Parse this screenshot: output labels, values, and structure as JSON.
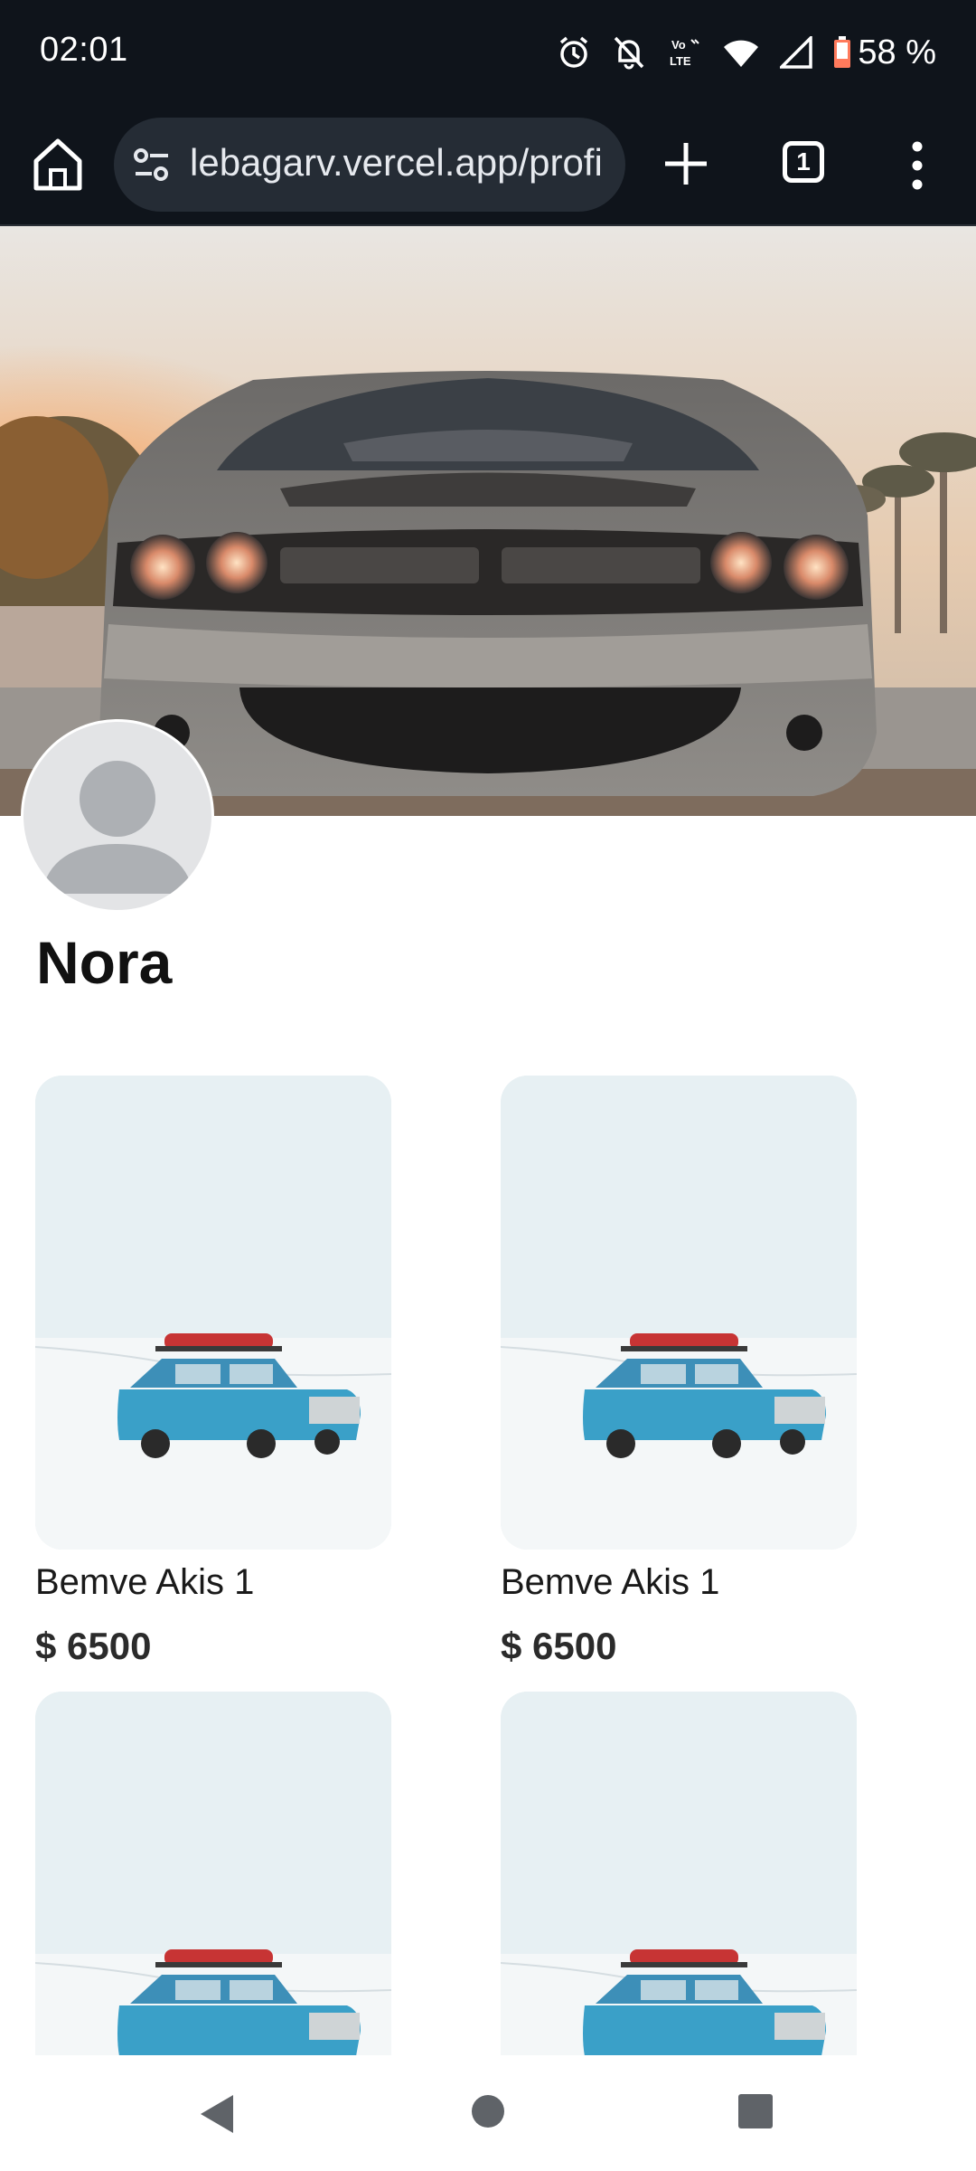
{
  "status_bar": {
    "time": "02:01",
    "battery_text": "58 %",
    "icons": [
      "alarm-icon",
      "bell-off-icon",
      "volte-icon",
      "wifi-icon",
      "signal-icon",
      "battery-icon"
    ]
  },
  "browser": {
    "url": "lebagarv.vercel.app/profi",
    "tab_count": "1",
    "icons": [
      "home-icon",
      "site-settings-icon",
      "plus-icon",
      "tabs-icon",
      "more-vert-icon"
    ]
  },
  "profile": {
    "name": "Nora"
  },
  "listings": [
    {
      "title": "Bemve Akis 1",
      "price": "$ 6500"
    },
    {
      "title": "Bemve Akis 1",
      "price": "$ 6500"
    },
    {
      "title": "",
      "price": ""
    },
    {
      "title": "",
      "price": ""
    }
  ],
  "nav": {
    "icons": [
      "back-icon",
      "home-circle-icon",
      "recents-icon"
    ]
  },
  "colors": {
    "system_bar": "#0f141b",
    "url_pill": "#252c35",
    "car_blue": "#3aa0c8",
    "snow": "#eef5f8"
  }
}
